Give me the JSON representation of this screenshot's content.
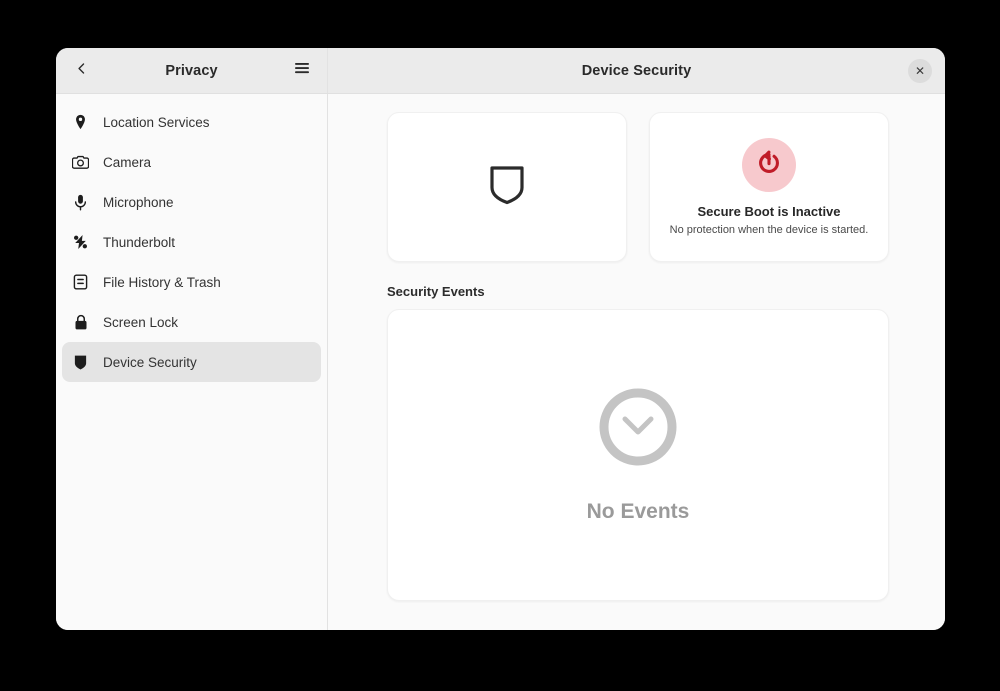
{
  "window": {
    "sidebar_header_title": "Privacy",
    "main_header_title": "Device Security",
    "back_icon": "chevron-left-icon",
    "menu_icon": "hamburger-menu-icon",
    "close_icon": "close-icon",
    "close_glyph": "✕"
  },
  "sidebar": {
    "items": [
      {
        "label": "Location Services",
        "icon": "location-pin-icon",
        "selected": false
      },
      {
        "label": "Camera",
        "icon": "camera-icon",
        "selected": false
      },
      {
        "label": "Microphone",
        "icon": "microphone-icon",
        "selected": false
      },
      {
        "label": "Thunderbolt",
        "icon": "thunderbolt-icon",
        "selected": false
      },
      {
        "label": "File History & Trash",
        "icon": "file-history-icon",
        "selected": false
      },
      {
        "label": "Screen Lock",
        "icon": "lock-icon",
        "selected": false
      },
      {
        "label": "Device Security",
        "icon": "shield-icon",
        "selected": true
      }
    ]
  },
  "main": {
    "cards": [
      {
        "icon": "shield-outline-icon",
        "title": "",
        "subtitle": ""
      },
      {
        "icon": "power-restart-icon",
        "title": "Secure Boot is Inactive",
        "subtitle": "No protection when the device is started."
      }
    ],
    "events_section": {
      "title": "Security Events",
      "empty_icon": "clock-icon",
      "empty_label": "No Events"
    }
  },
  "colors": {
    "accent_danger": "#c01c28",
    "danger_bg": "#f7c9cd",
    "window_bg": "#fafafa",
    "headerbar_bg": "#ebebeb",
    "selected_row": "#e4e4e4",
    "card_bg": "#ffffff",
    "empty_gray": "#c4c4c4",
    "desktop_bg": "#000000"
  }
}
